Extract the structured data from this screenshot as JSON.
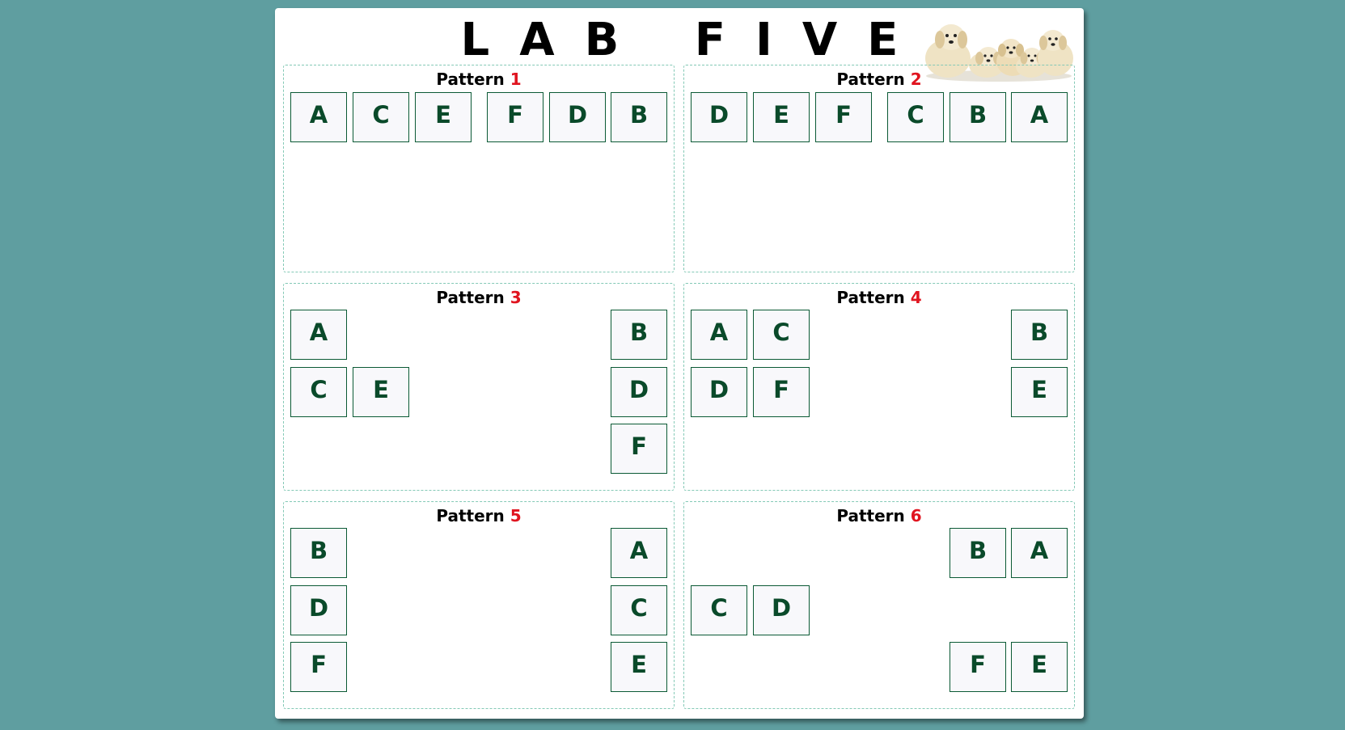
{
  "page": {
    "title": "LAB FIVE",
    "background_color": "#5f9ea0",
    "tile_text_color": "#0a4a2a",
    "tile_border_color": "#0b5a35",
    "number_color": "#e0141f",
    "header_image": "puppies-image"
  },
  "patterns": [
    {
      "label": "Pattern",
      "number": "1",
      "tiles": [
        "A",
        "C",
        "E",
        "F",
        "D",
        "B"
      ]
    },
    {
      "label": "Pattern",
      "number": "2",
      "tiles": [
        "D",
        "E",
        "F",
        "C",
        "B",
        "A"
      ]
    },
    {
      "label": "Pattern",
      "number": "3",
      "tiles": [
        "A",
        "B",
        "C",
        "E",
        "D",
        "F"
      ]
    },
    {
      "label": "Pattern",
      "number": "4",
      "tiles": [
        "A",
        "C",
        "B",
        "D",
        "F",
        "E"
      ]
    },
    {
      "label": "Pattern",
      "number": "5",
      "tiles": [
        "B",
        "A",
        "D",
        "C",
        "F",
        "E"
      ]
    },
    {
      "label": "Pattern",
      "number": "6",
      "tiles": [
        "B",
        "A",
        "C",
        "D",
        "F",
        "E"
      ]
    }
  ]
}
